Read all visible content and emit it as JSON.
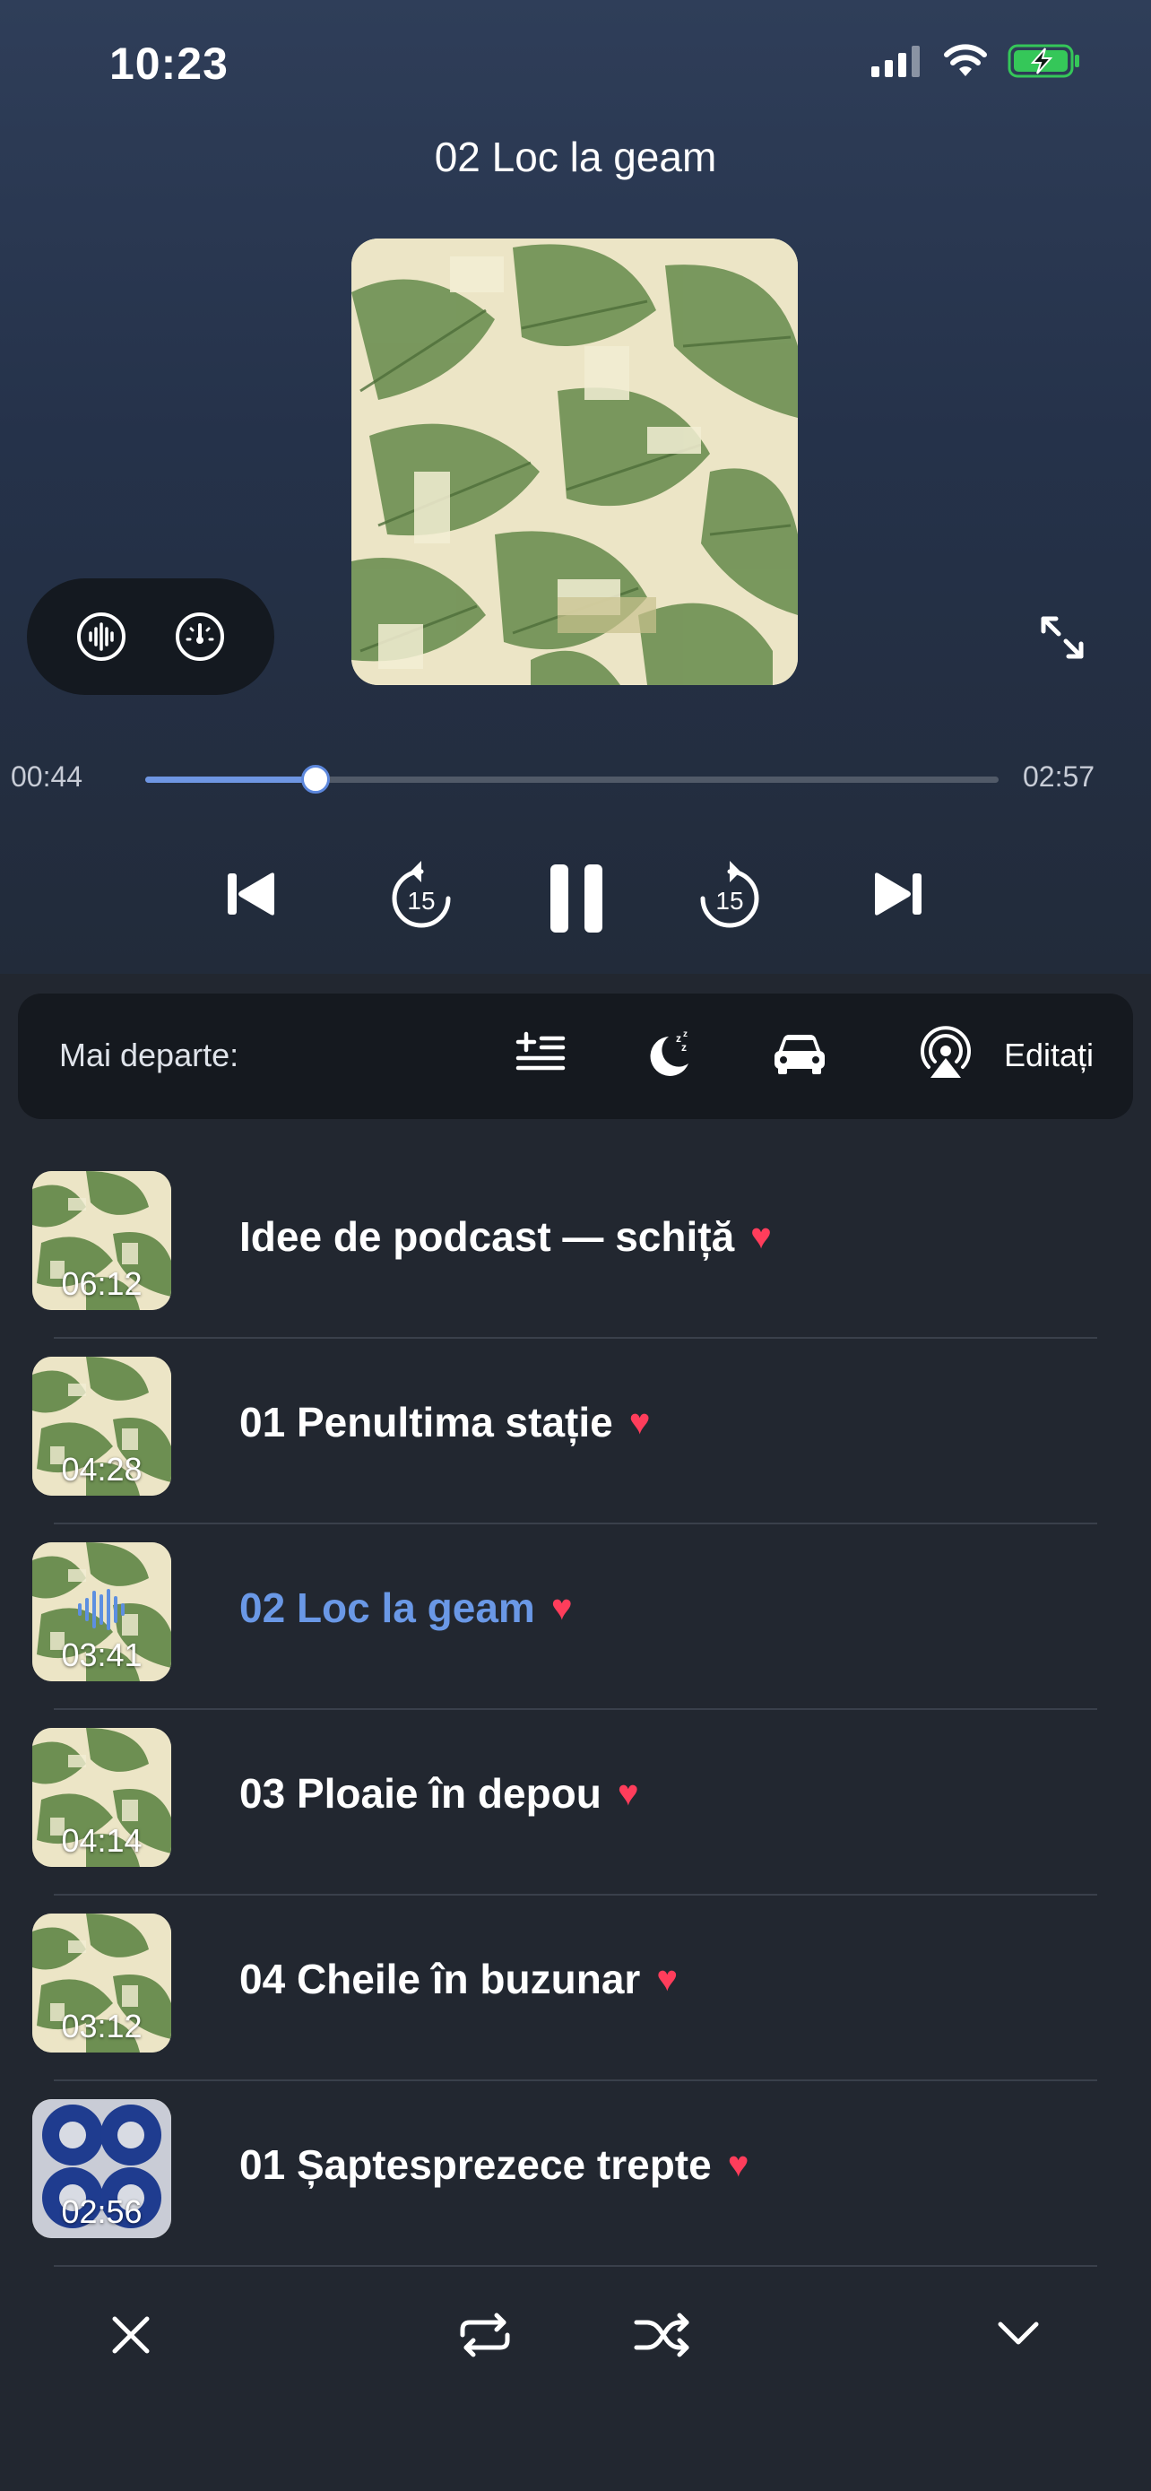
{
  "status": {
    "time": "10:23"
  },
  "now_playing": {
    "title": "02 Loc la geam",
    "elapsed": "00:44",
    "duration": "02:57",
    "progress_fraction": 0.2
  },
  "controls": {
    "skip_back_seconds": "15",
    "skip_forward_seconds": "15"
  },
  "up_next": {
    "label": "Mai departe:",
    "edit_label": "Editați"
  },
  "queue": [
    {
      "title": "Idee de podcast — schiță",
      "duration": "06:12",
      "liked": true,
      "active": false,
      "art": "leaves"
    },
    {
      "title": "01 Penultima stație",
      "duration": "04:28",
      "liked": true,
      "active": false,
      "art": "leaves"
    },
    {
      "title": "02 Loc la geam",
      "duration": "03:41",
      "liked": true,
      "active": true,
      "art": "leaves"
    },
    {
      "title": "03 Ploaie în depou",
      "duration": "04:14",
      "liked": true,
      "active": false,
      "art": "leaves"
    },
    {
      "title": "04 Cheile în buzunar",
      "duration": "03:12",
      "liked": true,
      "active": false,
      "art": "leaves"
    },
    {
      "title": "01 Șaptesprezece trepte",
      "duration": "02:56",
      "liked": true,
      "active": false,
      "art": "blue-circles"
    }
  ],
  "colors": {
    "accent": "#6a98e6",
    "heart": "#ff3d5b",
    "battery": "#35c759"
  }
}
